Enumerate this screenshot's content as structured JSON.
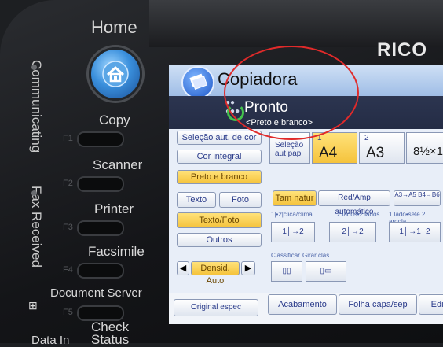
{
  "device": {
    "brand": "RICO"
  },
  "panel": {
    "home": "Home",
    "copy": "Copy",
    "scanner": "Scanner",
    "printer": "Printer",
    "facsimile": "Facsimile",
    "document_server": "Document Server",
    "check_status": "Check\nStatus",
    "data_in": "Data In",
    "communicating": "Communicating",
    "fax_received": "Fax Received",
    "f1": "F1",
    "f2": "F2",
    "f3": "F3",
    "f4": "F4",
    "f5": "F5"
  },
  "screen": {
    "title": "Copiadora",
    "status": "Pronto",
    "status_sub": "<Preto e branco>",
    "left": {
      "select_color": "Seleção aut. de cor",
      "full_color": "Cor integral",
      "black_white": "Preto e branco",
      "text": "Texto",
      "photo": "Foto",
      "text_photo": "Texto/Foto",
      "others": "Outros",
      "density": "Densid. Auto",
      "original": "Original espec"
    },
    "paper": {
      "auto_label": "Seleção aut pap",
      "tray1_num": "1",
      "tray1_size": "A4",
      "tray2_num": "2",
      "tray2_size": "A3",
      "tray3_size": "8½×1"
    },
    "zoom": {
      "natural": "Tam natur",
      "auto": "Red/Amp automático",
      "preset": "A3→A5 B4→B6"
    },
    "duplex": {
      "h1": "1|•2|clica/clima",
      "h2": "2 lados•2 lados",
      "h3": "1 lado•sete 2 argola"
    },
    "sort": {
      "h1": "Classificar",
      "h2": "Girar clas"
    },
    "bottom": {
      "finish": "Acabamento",
      "cover": "Folha capa/sep",
      "edit": "Editar"
    }
  },
  "colors": {
    "highlight": "#f5c33c",
    "accent_blue": "#1d57c9",
    "annotation_red": "#e02a2a"
  }
}
